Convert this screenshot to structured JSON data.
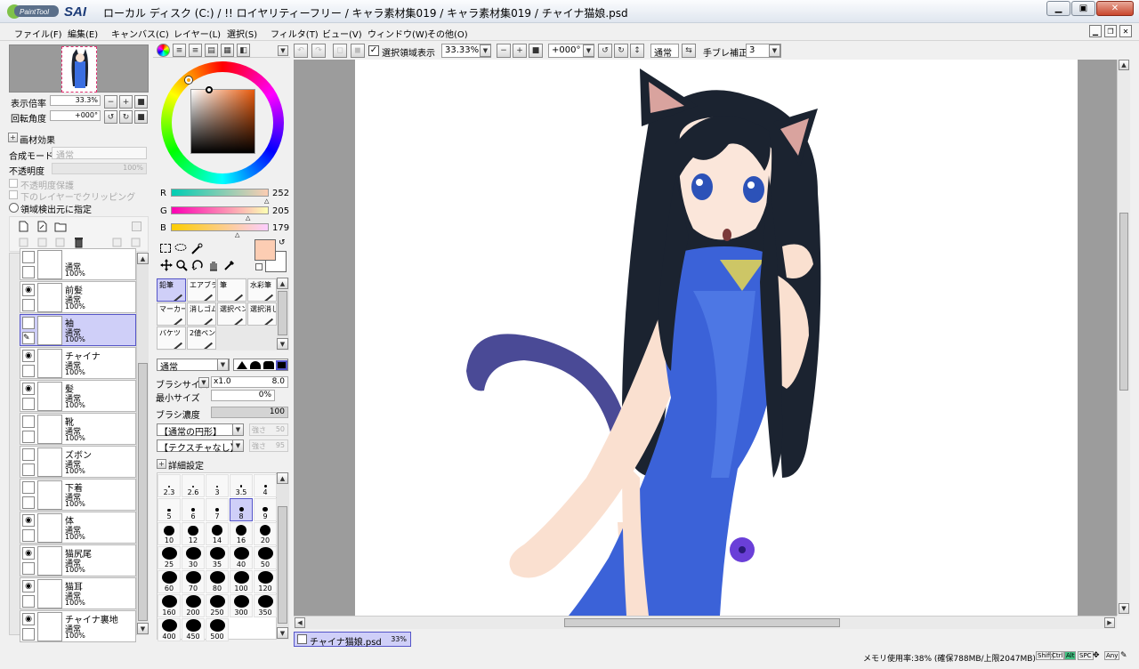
{
  "window": {
    "logo_text": "PaintTool SAI",
    "title": "ローカル ディスク (C:) / !! ロイヤリティーフリー / キャラ素材集019 / キャラ素材集019 / チャイナ猫娘.psd",
    "controls": [
      "minimize",
      "maximize",
      "close"
    ]
  },
  "menu": [
    "ファイル(F)",
    "編集(E)",
    "キャンバス(C)",
    "レイヤー(L)",
    "選択(S)",
    "フィルタ(T)",
    "ビュー(V)",
    "ウィンドウ(W)",
    "その他(O)"
  ],
  "navigator": {
    "zoom_label": "表示倍率",
    "zoom_value": "33.3%",
    "rotate_label": "回転角度",
    "rotate_value": "+000°"
  },
  "layer_props": {
    "effect_label": "画材効果",
    "blend_label": "合成モード",
    "blend_value": "通常",
    "opacity_label": "不透明度",
    "opacity_value": "100%",
    "preserve_opacity": "不透明度保護",
    "clip_lower": "下のレイヤーでクリッピング",
    "selection_source": "領域検出元に指定"
  },
  "layers": [
    {
      "name": "",
      "mode": "通常",
      "opacity": "100%",
      "visible": false
    },
    {
      "name": "前髪",
      "mode": "通常",
      "opacity": "100%",
      "visible": true
    },
    {
      "name": "袖",
      "mode": "通常",
      "opacity": "100%",
      "visible": false,
      "selected": true
    },
    {
      "name": "チャイナ",
      "mode": "通常",
      "opacity": "100%",
      "visible": true
    },
    {
      "name": "髪",
      "mode": "通常",
      "opacity": "100%",
      "visible": true
    },
    {
      "name": "靴",
      "mode": "通常",
      "opacity": "100%",
      "visible": false
    },
    {
      "name": "ズボン",
      "mode": "通常",
      "opacity": "100%",
      "visible": false
    },
    {
      "name": "下着",
      "mode": "通常",
      "opacity": "100%",
      "visible": false
    },
    {
      "name": "体",
      "mode": "通常",
      "opacity": "100%",
      "visible": true
    },
    {
      "name": "猫尻尾",
      "mode": "通常",
      "opacity": "100%",
      "visible": true
    },
    {
      "name": "猫耳",
      "mode": "通常",
      "opacity": "100%",
      "visible": true
    },
    {
      "name": "チャイナ裏地",
      "mode": "通常",
      "opacity": "100%",
      "visible": true
    }
  ],
  "color": {
    "r_label": "R",
    "r_value": "252",
    "g_label": "G",
    "g_value": "205",
    "b_label": "B",
    "b_value": "179",
    "current": "#fccdb3"
  },
  "tools": [
    {
      "label": "鉛筆",
      "selected": true
    },
    {
      "label": "エアブラシ"
    },
    {
      "label": "筆"
    },
    {
      "label": "水彩筆"
    },
    {
      "label": "マーカー"
    },
    {
      "label": "消しゴム"
    },
    {
      "label": "選択ペン"
    },
    {
      "label": "選択消し"
    },
    {
      "label": "バケツ"
    },
    {
      "label": "2値ペン"
    }
  ],
  "brush": {
    "mode": "通常",
    "size_label": "ブラシサイズ",
    "size_mult": "x1.0",
    "size_value": "8.0",
    "min_label": "最小サイズ",
    "min_value": "0%",
    "density_label": "ブラシ濃度",
    "density_value": "100",
    "shape": "【通常の円形】",
    "shape_strength_label": "強さ",
    "shape_strength": "50",
    "texture": "【テクスチャなし】",
    "texture_strength_label": "強さ",
    "texture_strength": "95",
    "advanced": "詳細設定",
    "sizes": [
      "2.3",
      "2.6",
      "3",
      "3.5",
      "4",
      "5",
      "6",
      "7",
      "8",
      "9",
      "10",
      "12",
      "14",
      "16",
      "20",
      "25",
      "30",
      "35",
      "40",
      "50",
      "60",
      "70",
      "80",
      "100",
      "120",
      "160",
      "200",
      "250",
      "300",
      "350",
      "400",
      "450",
      "500"
    ],
    "selected_size": "8"
  },
  "toolbar": {
    "show_selection": "選択領域表示",
    "zoom": "33.33%",
    "angle": "+000°",
    "mode": "通常",
    "stabilizer_label": "手ブレ補正",
    "stabilizer_value": "3"
  },
  "tabs": [
    {
      "name": "チャイナ猫娘.psd",
      "zoom": "33%"
    }
  ],
  "status": {
    "memory": "メモリ使用率:38% (確保788MB/上限2047MB)",
    "keys": [
      "Shift",
      "Ctrl",
      "Alt",
      "SPC",
      "Any"
    ]
  }
}
